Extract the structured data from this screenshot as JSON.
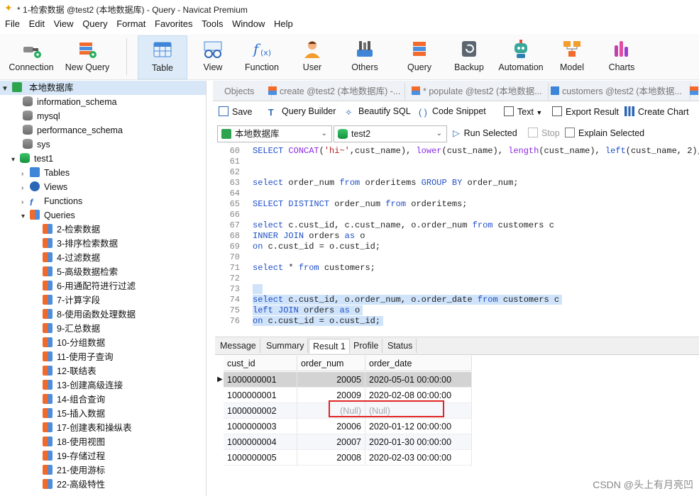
{
  "window": {
    "title": "* 1-检索数据 @test2 (本地数据库) - Query - Navicat Premium"
  },
  "menu": [
    "File",
    "Edit",
    "View",
    "Query",
    "Format",
    "Favorites",
    "Tools",
    "Window",
    "Help"
  ],
  "toolbar": [
    {
      "label": "Connection",
      "icon": "connection-icon"
    },
    {
      "label": "New Query",
      "icon": "new-query-icon"
    },
    {
      "label": "Table",
      "icon": "table-icon",
      "active": true
    },
    {
      "label": "View",
      "icon": "view-icon"
    },
    {
      "label": "Function",
      "icon": "function-icon"
    },
    {
      "label": "User",
      "icon": "user-icon"
    },
    {
      "label": "Others",
      "icon": "others-icon"
    },
    {
      "label": "Query",
      "icon": "query-icon"
    },
    {
      "label": "Backup",
      "icon": "backup-icon"
    },
    {
      "label": "Automation",
      "icon": "automation-icon"
    },
    {
      "label": "Model",
      "icon": "model-icon"
    },
    {
      "label": "Charts",
      "icon": "charts-icon"
    }
  ],
  "tree": {
    "connection": "本地数据库",
    "databases": [
      "information_schema",
      "mysql",
      "performance_schema",
      "sys",
      "test1"
    ],
    "groups": [
      "Tables",
      "Views",
      "Functions",
      "Queries"
    ],
    "queries": [
      "2-检索数据",
      "3-排序检索数据",
      "4-过滤数据",
      "5-高级数据检索",
      "6-用通配符进行过滤",
      "7-计算字段",
      "8-使用函数处理数据",
      "9-汇总数据",
      "10-分组数据",
      "11-使用子查询",
      "12-联结表",
      "13-创建高级连接",
      "14-组合查询",
      "15-插入数据",
      "17-创建表和操纵表",
      "18-使用视图",
      "19-存储过程",
      "21-使用游标",
      "22-高级特性"
    ]
  },
  "tabs": [
    "Objects",
    "create @test2 (本地数据库) -...",
    "* populate @test2 (本地数据...",
    "customers @test2 (本地数据..."
  ],
  "editor_toolbar": {
    "save": "Save",
    "query_builder": "Query Builder",
    "beautify": "Beautify SQL",
    "snippet": "Code Snippet",
    "text": "Text",
    "export": "Export Result",
    "create_chart": "Create Chart",
    "connection": "本地数据库",
    "database": "test2",
    "run_selected": "Run Selected",
    "stop": "Stop",
    "explain": "Explain Selected"
  },
  "code_lines": [
    {
      "n": "60",
      "t": "SELECT CONCAT('hi~',cust_name), lower(cust_name), length(cust_name), left(cust_name, 2), S"
    },
    {
      "n": "61",
      "t": ""
    },
    {
      "n": "62",
      "t": ""
    },
    {
      "n": "63",
      "t": "select order_num from orderitems GROUP BY order_num;"
    },
    {
      "n": "64",
      "t": ""
    },
    {
      "n": "65",
      "t": "SELECT DISTINCT order_num from orderitems;"
    },
    {
      "n": "66",
      "t": ""
    },
    {
      "n": "67",
      "t": "select c.cust_id, c.cust_name, o.order_num from customers c"
    },
    {
      "n": "68",
      "t": "INNER JOIN orders as o"
    },
    {
      "n": "69",
      "t": "on c.cust_id = o.cust_id;"
    },
    {
      "n": "70",
      "t": ""
    },
    {
      "n": "71",
      "t": "select * from customers;"
    },
    {
      "n": "72",
      "t": ""
    },
    {
      "n": "73",
      "t": ""
    },
    {
      "n": "74",
      "t": "select c.cust_id, o.order_num, o.order_date from customers c"
    },
    {
      "n": "75",
      "t": "left JOIN orders as o"
    },
    {
      "n": "76",
      "t": "on c.cust_id = o.cust_id;"
    }
  ],
  "result_tabs": [
    "Message",
    "Summary",
    "Result 1",
    "Profile",
    "Status"
  ],
  "grid": {
    "columns": [
      "cust_id",
      "order_num",
      "order_date"
    ],
    "rows": [
      [
        "1000000001",
        "20005",
        "2020-05-01 00:00:00"
      ],
      [
        "1000000001",
        "20009",
        "2020-02-08 00:00:00"
      ],
      [
        "1000000002",
        "(Null)",
        "(Null)"
      ],
      [
        "1000000003",
        "20006",
        "2020-01-12 00:00:00"
      ],
      [
        "1000000004",
        "20007",
        "2020-01-30 00:00:00"
      ],
      [
        "1000000005",
        "20008",
        "2020-02-03 00:00:00"
      ]
    ]
  },
  "watermark": "CSDN @头上有月亮凹"
}
